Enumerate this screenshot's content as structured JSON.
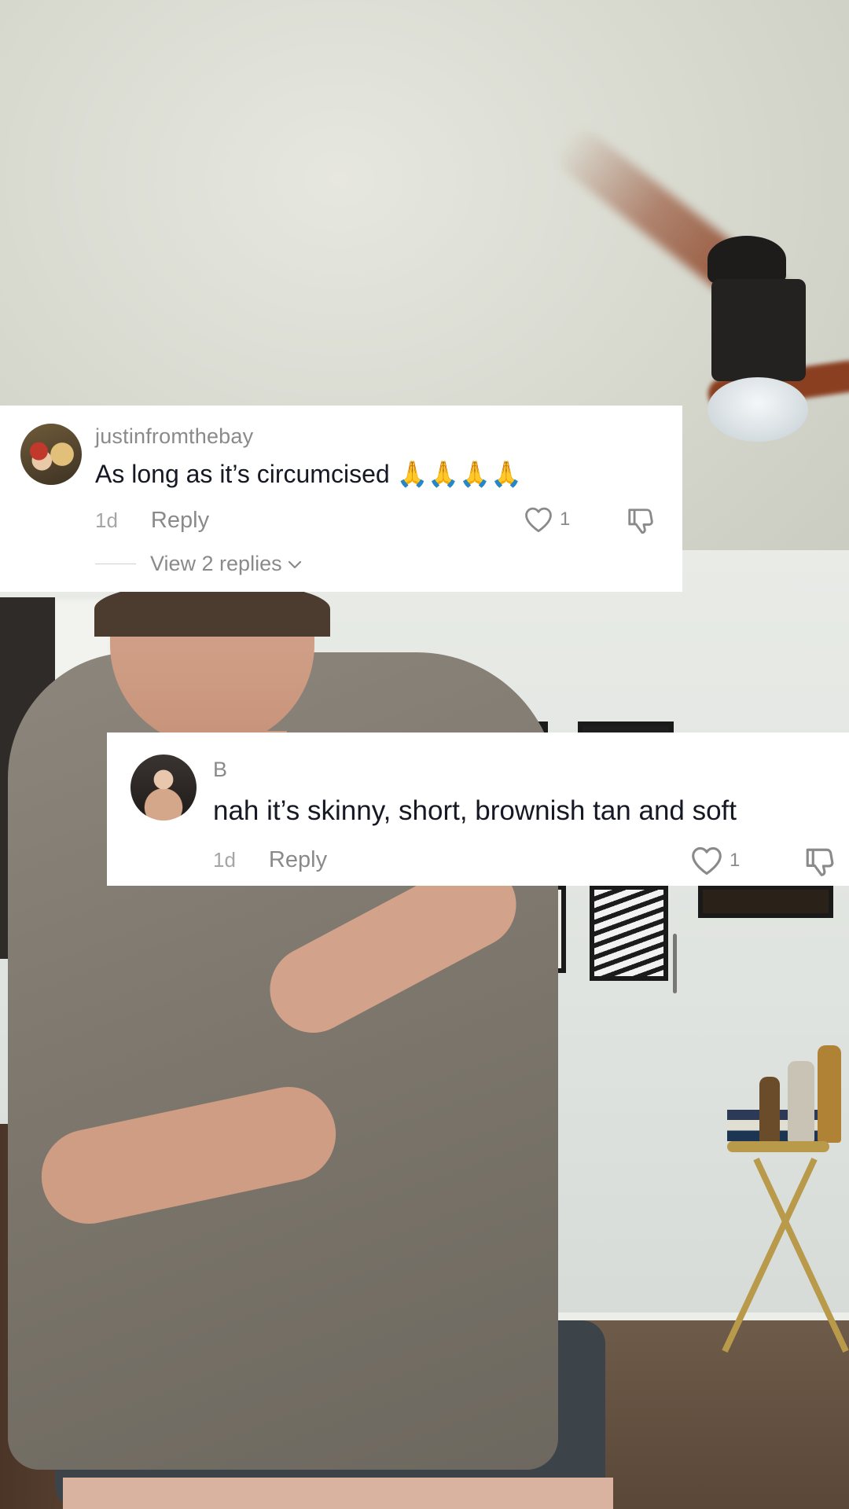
{
  "comments": [
    {
      "username": "justinfromthebay",
      "text": "As long as it’s circumcised 🙏🙏🙏🙏",
      "time": "1d",
      "reply_label": "Reply",
      "like_count": "1",
      "view_replies_label": "View 2 replies"
    },
    {
      "username": "B",
      "text": "nah it’s skinny, short, brownish tan and soft",
      "time": "1d",
      "reply_label": "Reply",
      "like_count": "1"
    }
  ],
  "icons": {
    "like": "heart-outline-icon",
    "dislike": "thumbs-down-icon",
    "expand": "chevron-down-icon"
  },
  "colors": {
    "card_background": "#ffffff",
    "primary_text": "#161823",
    "secondary_text": "#8a8a8a"
  }
}
